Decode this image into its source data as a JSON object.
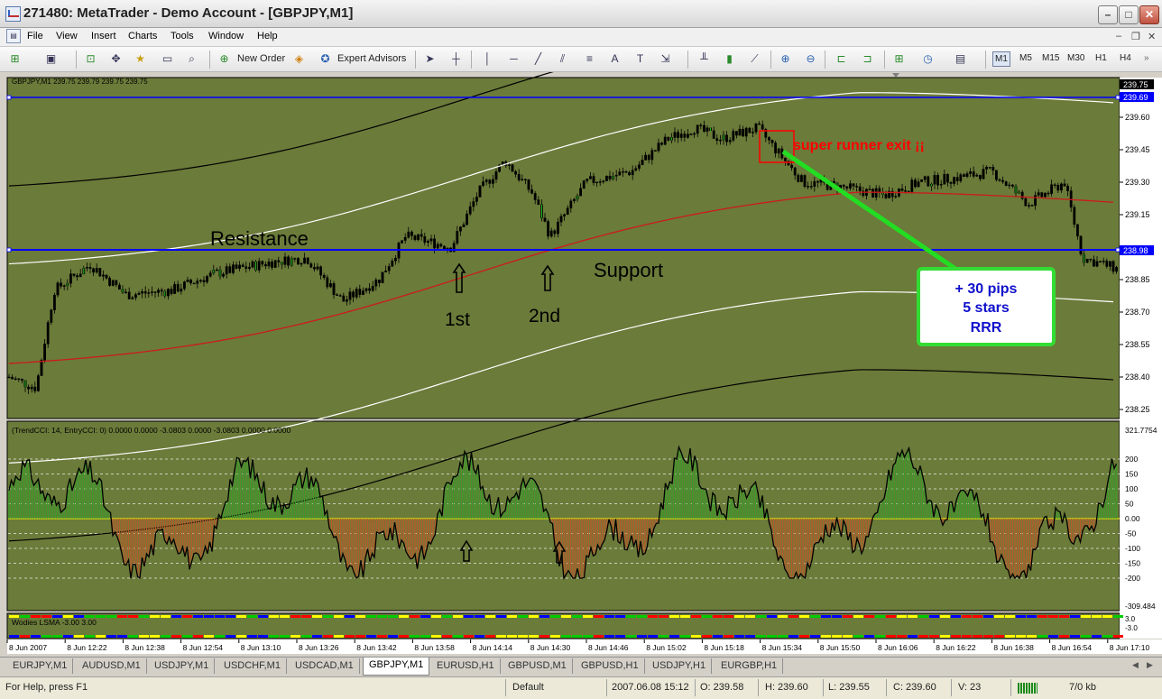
{
  "window": {
    "title": "271480: MetaTrader - Demo Account - [GBPJPY,M1]"
  },
  "menu": [
    "File",
    "View",
    "Insert",
    "Charts",
    "Tools",
    "Window",
    "Help"
  ],
  "toolbar": {
    "new_order_label": "New Order",
    "expert_advisors_label": "Expert Advisors",
    "timeframes": [
      "M1",
      "M5",
      "M15",
      "M30",
      "H1",
      "H4"
    ],
    "active_timeframe": "M1"
  },
  "chart": {
    "symbol_info": "GBPJPY,M1  239.75 239.79 239.75 239.75",
    "indicator1_label": "(TrendCCI: 14, EntryCCI: 0)  0.0000 0.0000 -3.0803 0.0000 -3.0803 0.0000 0.0000",
    "indicator2_label": "Wodies LSMA -3.00 3.00",
    "price_levels": [
      "239.60",
      "239.45",
      "239.30",
      "239.15",
      "238.85",
      "238.70",
      "238.55",
      "238.40",
      "238.25"
    ],
    "price_current": "239.75",
    "price_line_top": "239.69",
    "price_line_bottom": "238.98",
    "cci_levels": [
      "321.7754",
      "200",
      "150",
      "100",
      "50",
      "0.00",
      "-50",
      "-100",
      "-150",
      "-200",
      "-309.484"
    ],
    "lsma_levels": [
      "3.0",
      "-3.0"
    ],
    "time_labels": [
      "8 Jun 2007",
      "8 Jun 12:22",
      "8 Jun 12:38",
      "8 Jun 12:54",
      "8 Jun 13:10",
      "8 Jun 13:26",
      "8 Jun 13:42",
      "8 Jun 13:58",
      "8 Jun 14:14",
      "8 Jun 14:30",
      "8 Jun 14:46",
      "8 Jun 15:02",
      "8 Jun 15:18",
      "8 Jun 15:34",
      "8 Jun 15:50",
      "8 Jun 16:06",
      "8 Jun 16:22",
      "8 Jun 16:38",
      "8 Jun 16:54",
      "8 Jun 17:10"
    ],
    "annotations": {
      "resistance": "Resistance",
      "support": "Support",
      "first": "1st",
      "second": "2nd",
      "exit": "super runner exit ¡¡",
      "box_line1": "+ 30 pips",
      "box_line2": "5 stars",
      "box_line3": "RRR"
    },
    "colors": {
      "background": "#6b7b3a",
      "bollinger_mid": "#cc1b1b",
      "blue_line": "#0000ff",
      "callout_border": "#33dd33",
      "callout_text": "#1010cc",
      "exit_text": "#ff0000"
    }
  },
  "tabs": [
    "EURJPY,M1",
    "AUDUSD,M1",
    "USDJPY,M1",
    "USDCHF,M1",
    "USDCAD,M1",
    "GBPJPY,M1",
    "EURUSD,H1",
    "GBPUSD,M1",
    "GBPUSD,H1",
    "USDJPY,H1",
    "EURGBP,H1"
  ],
  "active_tab": "GBPJPY,M1",
  "status": {
    "help": "For Help, press F1",
    "profile": "Default",
    "datetime": "2007.06.08 15:12",
    "open": "O: 239.58",
    "high": "H: 239.60",
    "low": "L: 239.55",
    "close": "C: 239.60",
    "volume": "V: 23",
    "traffic": "7/0 kb"
  }
}
